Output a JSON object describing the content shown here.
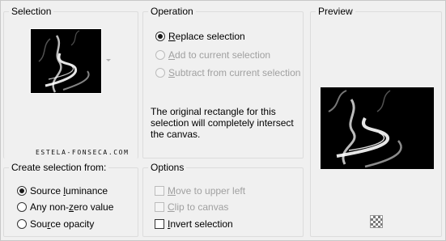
{
  "selection": {
    "title": "Selection",
    "watermark": "ESTELA-FONSECA.COM"
  },
  "operation": {
    "title": "Operation",
    "options": [
      {
        "pre": "",
        "accel": "R",
        "post": "eplace selection",
        "selected": true,
        "enabled": true
      },
      {
        "pre": "",
        "accel": "A",
        "post": "dd to current selection",
        "selected": false,
        "enabled": false
      },
      {
        "pre": "",
        "accel": "S",
        "post": "ubtract from current selection",
        "selected": false,
        "enabled": false
      }
    ],
    "note_lines": [
      "The original rectangle for this",
      "selection will completely intersect",
      "the canvas."
    ]
  },
  "preview": {
    "title": "Preview"
  },
  "create_from": {
    "title": "Create selection from:",
    "options": [
      {
        "pre": "Source ",
        "accel": "l",
        "post": "uminance",
        "selected": true
      },
      {
        "pre": "Any non-",
        "accel": "z",
        "post": "ero value",
        "selected": false
      },
      {
        "pre": "Sou",
        "accel": "r",
        "post": "ce opacity",
        "selected": false
      }
    ]
  },
  "options": {
    "title": "Options",
    "checks": [
      {
        "pre": "",
        "accel": "M",
        "post": "ove to upper left",
        "checked": false,
        "enabled": false
      },
      {
        "pre": "",
        "accel": "C",
        "post": "lip to canvas",
        "checked": false,
        "enabled": false
      },
      {
        "pre": "",
        "accel": "I",
        "post": "nvert selection",
        "checked": false,
        "enabled": true
      }
    ]
  },
  "colors": {
    "background": "#f0f0f0",
    "group_border": "#dcdcdc",
    "disabled_text": "#a0a0a0",
    "smoke_bg": "#000000"
  },
  "icons": [
    "chevron-down-icon",
    "transparency-checker-icon",
    "smoke-image"
  ]
}
